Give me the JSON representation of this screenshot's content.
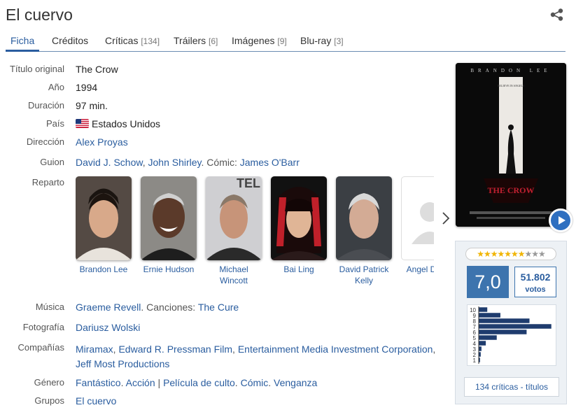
{
  "title": "El cuervo",
  "tabs": [
    {
      "label": "Ficha",
      "count": ""
    },
    {
      "label": "Créditos",
      "count": ""
    },
    {
      "label": "Críticas",
      "count": "[134]"
    },
    {
      "label": "Tráilers",
      "count": "[6]"
    },
    {
      "label": "Imágenes",
      "count": "[9]"
    },
    {
      "label": "Blu-ray",
      "count": "[3]"
    }
  ],
  "fields": {
    "original_title": {
      "label": "Título original",
      "value": "The Crow"
    },
    "year": {
      "label": "Año",
      "value": "1994"
    },
    "duration": {
      "label": "Duración",
      "value": "97 min."
    },
    "country": {
      "label": "País",
      "value": "Estados Unidos"
    },
    "direction": {
      "label": "Dirección",
      "value": "Alex Proyas"
    },
    "script": {
      "label": "Guion",
      "writer1": "David J. Schow",
      "writer2": "John Shirley",
      "comic_label": "Cómic:",
      "comic": "James O'Barr"
    },
    "cast_label": "Reparto",
    "music": {
      "label": "Música",
      "composer": "Graeme Revell",
      "songs_label": "Canciones:",
      "songs": "The Cure"
    },
    "photography": {
      "label": "Fotografía",
      "value": "Dariusz Wolski"
    },
    "companies": {
      "label": "Compañías",
      "c1": "Miramax",
      "c2": "Edward R. Pressman Film",
      "c3": "Entertainment Media Investment Corporation",
      "c4": "Jeff Most Productions"
    },
    "genre": {
      "label": "Género",
      "g1": "Fantástico",
      "g2": "Acción",
      "g3": "Película de culto",
      "g4": "Cómic",
      "g5": "Venganza"
    },
    "groups": {
      "label": "Grupos",
      "value": "El cuervo"
    }
  },
  "cast": [
    {
      "name": "Brandon Lee"
    },
    {
      "name": "Ernie Hudson"
    },
    {
      "name": "Michael Wincott"
    },
    {
      "name": "Bai Ling"
    },
    {
      "name": "David Patrick Kelly"
    },
    {
      "name": "Angel David"
    }
  ],
  "poster": {
    "top_text": "BRANDON LEE",
    "tagline": "BELIEVE IN ANGELS",
    "logo": "THE CROW"
  },
  "rating": {
    "average": "7,0",
    "votes": "51.802",
    "votes_label": "votos",
    "stars_filled": 7,
    "stars_total": 10,
    "critics_link": "134 críticas - títulos"
  },
  "histogram": {
    "labels": [
      "10",
      "9",
      "8",
      "7",
      "6",
      "5",
      "4",
      "3",
      "2",
      "1"
    ],
    "values": [
      12,
      30,
      70,
      100,
      66,
      25,
      10,
      4,
      3,
      2
    ]
  },
  "colors": {
    "accent": "#2a5d9f",
    "rating_bg": "#3d74ae"
  }
}
